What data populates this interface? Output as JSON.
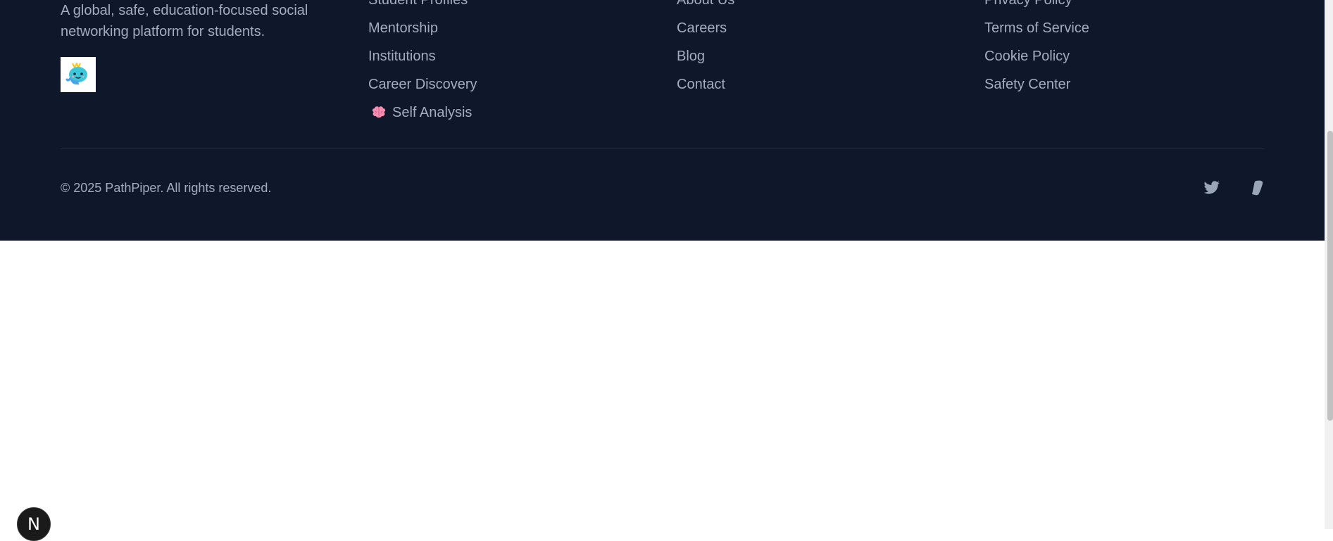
{
  "footer": {
    "tagline": "A global, safe, education-focused social networking platform for students.",
    "logo_icon": "mascot-logo-icon",
    "columns": [
      {
        "links": [
          {
            "label": "Student Profiles"
          },
          {
            "label": "Mentorship"
          },
          {
            "label": "Institutions"
          },
          {
            "label": "Career Discovery"
          },
          {
            "label": "Self Analysis",
            "icon": "brain-icon"
          }
        ]
      },
      {
        "links": [
          {
            "label": "About Us"
          },
          {
            "label": "Careers"
          },
          {
            "label": "Blog"
          },
          {
            "label": "Contact"
          }
        ]
      },
      {
        "links": [
          {
            "label": "Privacy Policy"
          },
          {
            "label": "Terms of Service"
          },
          {
            "label": "Cookie Policy"
          },
          {
            "label": "Safety Center"
          }
        ]
      }
    ],
    "copyright": "© 2025 PathPiper. All rights reserved.",
    "social": [
      {
        "icon": "twitter-icon"
      },
      {
        "icon": "social-icon"
      }
    ]
  },
  "dev_badge": {
    "label": "N"
  },
  "colors": {
    "footer_bg": "#0f172a",
    "footer_text": "#a3adbf",
    "page_bg": "#ffffff"
  }
}
